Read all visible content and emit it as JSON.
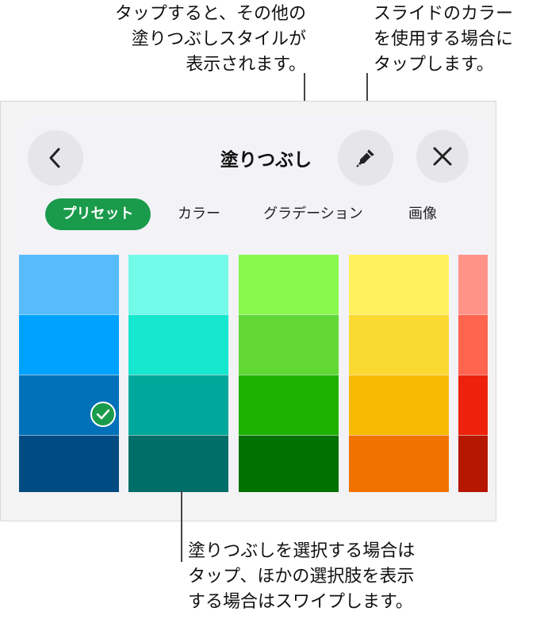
{
  "callouts": {
    "fill_styles": "タップすると、その他の\n塗りつぶしスタイルが\n表示されます。",
    "slide_color": "スライドのカラー\nを使用する場合に\nタップします。",
    "swipe": "塗りつぶしを選択する場合は\nタップ、ほかの選択肢を表示\nする場合はスワイプします。"
  },
  "panel": {
    "title": "塗りつぶし",
    "back_icon": "chevron-left-icon",
    "eyedropper_icon": "eyedropper-icon",
    "close_icon": "close-icon"
  },
  "tabs": [
    {
      "label": "プリセット",
      "selected": true
    },
    {
      "label": "カラー",
      "selected": false
    },
    {
      "label": "グラデーション",
      "selected": false
    },
    {
      "label": "画像",
      "selected": false
    }
  ],
  "swatch_columns": [
    {
      "name": "blue",
      "colors": [
        "#58bcfb",
        "#00a2ff",
        "#0071b8",
        "#004c82"
      ]
    },
    {
      "name": "teal",
      "colors": [
        "#73fae9",
        "#16e7cf",
        "#00a89b",
        "#006e68"
      ]
    },
    {
      "name": "green",
      "colors": [
        "#88f94e",
        "#61d836",
        "#1db100",
        "#017100"
      ]
    },
    {
      "name": "yellow",
      "colors": [
        "#fff05c",
        "#fad932",
        "#f8ba00",
        "#f27200"
      ]
    },
    {
      "name": "red",
      "colors": [
        "#ff9388",
        "#ff644e",
        "#ee220c",
        "#b51700"
      ]
    }
  ],
  "selected_swatch": {
    "column": "blue",
    "index": 2
  },
  "accent_color": "#1a9b4b"
}
